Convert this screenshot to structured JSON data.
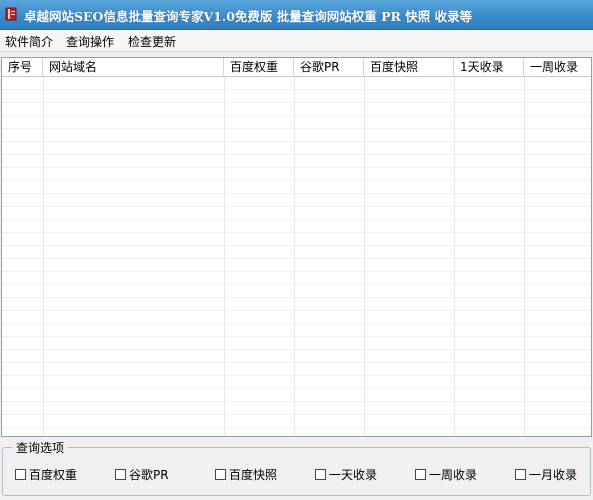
{
  "window": {
    "title": "卓越网站SEO信息批量查询专家V1.0免费版 批量查询网站权重 PR 快照 收录等",
    "icon": "book-icon",
    "title_bar_color": "#3b8ccc"
  },
  "menu": {
    "items": [
      {
        "label": "软件简介"
      },
      {
        "label": "查询操作"
      },
      {
        "label": "检查更新"
      }
    ]
  },
  "table": {
    "columns": [
      {
        "label": "序号"
      },
      {
        "label": "网站域名"
      },
      {
        "label": "百度权重"
      },
      {
        "label": "谷歌PR"
      },
      {
        "label": "百度快照"
      },
      {
        "label": "1天收录"
      },
      {
        "label": "一周收录"
      }
    ],
    "rows": []
  },
  "query_options": {
    "title": "查询选项",
    "options": [
      {
        "label": "百度权重",
        "checked": false
      },
      {
        "label": "谷歌PR",
        "checked": false
      },
      {
        "label": "百度快照",
        "checked": false
      },
      {
        "label": "一天收录",
        "checked": false
      },
      {
        "label": "一周收录",
        "checked": false
      },
      {
        "label": "一月收录",
        "checked": false
      }
    ]
  }
}
